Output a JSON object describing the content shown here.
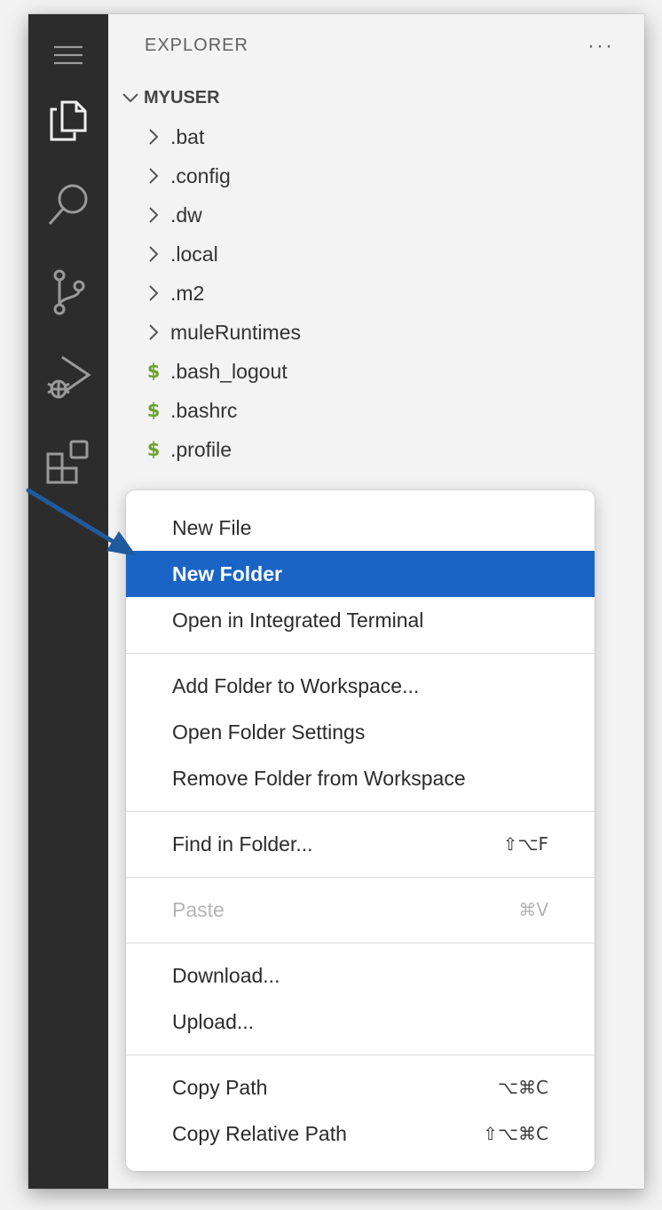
{
  "explorer": {
    "title": "EXPLORER",
    "more_icon": "ellipsis-icon",
    "root_name": "MYUSER",
    "items": [
      {
        "label": ".bat",
        "kind": "folder"
      },
      {
        "label": ".config",
        "kind": "folder"
      },
      {
        "label": ".dw",
        "kind": "folder"
      },
      {
        "label": ".local",
        "kind": "folder"
      },
      {
        "label": ".m2",
        "kind": "folder"
      },
      {
        "label": "muleRuntimes",
        "kind": "folder"
      },
      {
        "label": ".bash_logout",
        "kind": "shell-file"
      },
      {
        "label": ".bashrc",
        "kind": "shell-file"
      },
      {
        "label": ".profile",
        "kind": "shell-file"
      }
    ],
    "file_glyph": "$"
  },
  "activity_bar": {
    "icons": [
      "menu-icon",
      "explorer-files-icon",
      "search-icon",
      "source-control-icon",
      "run-debug-icon",
      "extensions-icon"
    ]
  },
  "context_menu": {
    "groups": [
      [
        {
          "label": "New File",
          "shortcut": ""
        },
        {
          "label": "New Folder",
          "shortcut": "",
          "highlighted": true
        },
        {
          "label": "Open in Integrated Terminal",
          "shortcut": ""
        }
      ],
      [
        {
          "label": "Add Folder to Workspace...",
          "shortcut": ""
        },
        {
          "label": "Open Folder Settings",
          "shortcut": ""
        },
        {
          "label": "Remove Folder from Workspace",
          "shortcut": ""
        }
      ],
      [
        {
          "label": "Find in Folder...",
          "shortcut": "⇧⌥F"
        }
      ],
      [
        {
          "label": "Paste",
          "shortcut": "⌘V",
          "disabled": true
        }
      ],
      [
        {
          "label": "Download...",
          "shortcut": ""
        },
        {
          "label": "Upload...",
          "shortcut": ""
        }
      ],
      [
        {
          "label": "Copy Path",
          "shortcut": "⌥⌘C"
        },
        {
          "label": "Copy Relative Path",
          "shortcut": "⇧⌥⌘C"
        }
      ]
    ]
  },
  "colors": {
    "activity_bar": "#2c2c2c",
    "sidebar": "#f3f3f3",
    "highlight": "#1a64c5",
    "shell_icon": "#6ba32b",
    "arrow": "#1f5a9e"
  }
}
